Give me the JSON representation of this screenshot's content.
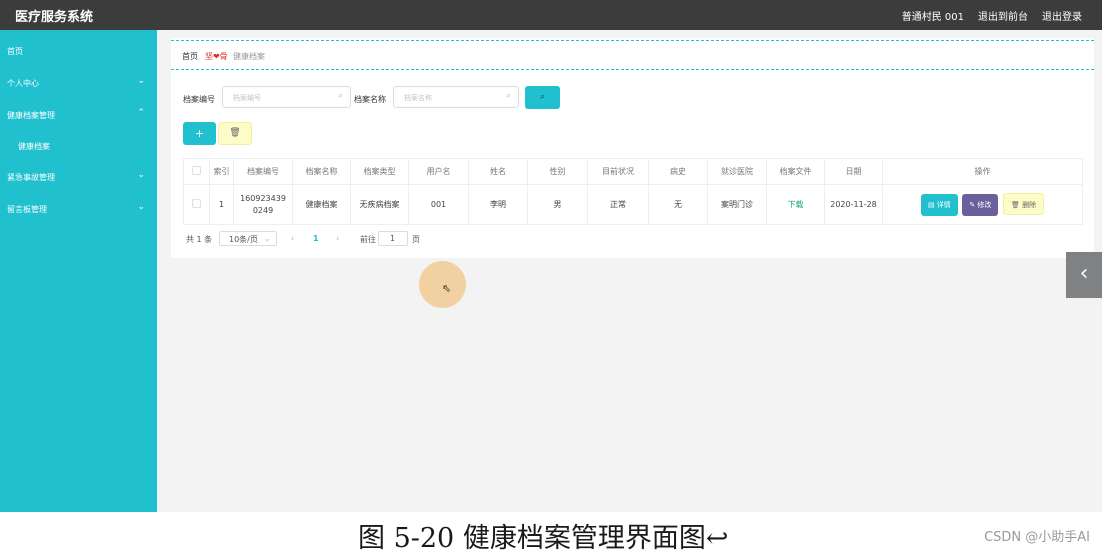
{
  "app": {
    "title": "医疗服务系统",
    "user_label": "普通村民 001",
    "front_link": "退出到前台",
    "logout_link": "退出登录"
  },
  "sidebar": {
    "items": [
      {
        "label": "首页",
        "arrow": ""
      },
      {
        "label": "个人中心",
        "arrow": "⌄"
      },
      {
        "label": "健康档案管理",
        "arrow": "⌃"
      },
      {
        "label": "健康档案",
        "arrow": ""
      },
      {
        "label": "紧急事故管理",
        "arrow": "⌄"
      },
      {
        "label": "留言板管理",
        "arrow": "⌄"
      }
    ]
  },
  "breadcrumb": {
    "home": "首页",
    "brand": "坚❤骨",
    "current": "健康档案"
  },
  "search": {
    "field1_label": "档案编号",
    "field1_placeholder": "档案编号",
    "field2_label": "档案名称",
    "field2_placeholder": "档案名称",
    "search_icon": "⌕"
  },
  "actions": {
    "add_label": "+",
    "delete_icon": "🗑"
  },
  "table": {
    "columns": [
      "",
      "索引",
      "档案编号",
      "档案名称",
      "档案类型",
      "用户名",
      "姓名",
      "性别",
      "目前状况",
      "病史",
      "就诊医院",
      "档案文件",
      "日期",
      "操作"
    ],
    "rows": [
      {
        "index": "1",
        "code": "1609234390249",
        "name": "健康档案",
        "type": "无疾病档案",
        "username": "001",
        "person": "李明",
        "gender": "男",
        "status": "正常",
        "history": "无",
        "hospital": "案明门诊",
        "file": "下载",
        "date": "2020-11-28",
        "ops": {
          "detail": "详情",
          "edit": "修改",
          "delete": "删除"
        }
      }
    ]
  },
  "pager": {
    "total": "共 1 条",
    "size": "10条/页",
    "prev": "‹",
    "page": "1",
    "next": "›",
    "goto_prefix": "前往",
    "goto_value": "1",
    "goto_suffix": "页"
  },
  "side_toggle": "‹",
  "caption": {
    "text": "图 5-20 健康档案管理界面图↩",
    "watermark": "CSDN @小助手AI"
  },
  "colors": {
    "accent": "#21c0cf",
    "topbar": "#3c3c3c",
    "edit_button": "#6b5f9c",
    "delete_button": "#fdfcc7"
  }
}
